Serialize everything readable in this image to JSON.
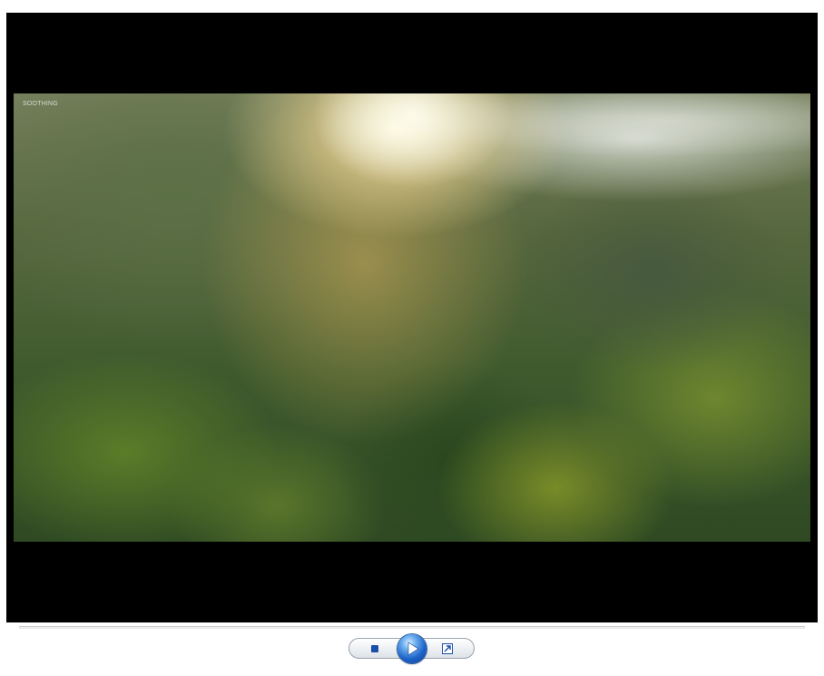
{
  "player": {
    "state": "paused",
    "progress": 0.0
  },
  "video": {
    "watermark": "SOOTHING"
  },
  "controls": {
    "stop_icon": "stop-icon",
    "play_icon": "play-icon",
    "fullscreen_icon": "fullscreen-icon"
  },
  "colors": {
    "frame_background": "#000000",
    "accent_blue": "#1d63c8"
  }
}
